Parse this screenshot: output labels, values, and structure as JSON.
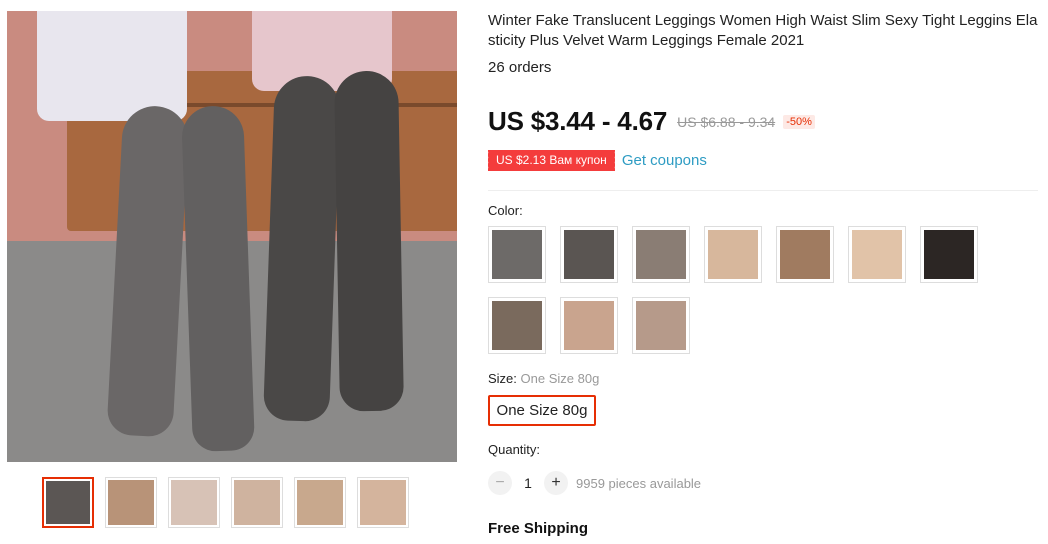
{
  "product": {
    "title": "Winter Fake Translucent Leggings Women High Waist Slim Sexy Tight Leggins Elasticity Plus Velvet Warm Leggings Female 2021",
    "orders": "26 orders",
    "price": "US $3.44 - 4.67",
    "original_price": "US $6.88 - 9.34",
    "discount": "-50%"
  },
  "coupon": {
    "label": "US $2.13 Вам купон",
    "link": "Get coupons"
  },
  "color": {
    "label": "Color:",
    "swatch_colors": [
      "#6d6a68",
      "#5a5552",
      "#8a7d74",
      "#d7b79c",
      "#a07b60",
      "#e1c3a8",
      "#2c2624",
      "#7a6a5d",
      "#c9a48e",
      "#b69a8a"
    ]
  },
  "size": {
    "label": "Size:",
    "selected_hint": "One Size 80g",
    "option": "One Size 80g"
  },
  "quantity": {
    "label": "Quantity:",
    "minus": "−",
    "value": "1",
    "plus": "+",
    "available": "9959 pieces available"
  },
  "shipping": {
    "label": "Free Shipping"
  },
  "gallery": {
    "thumb_colors": [
      "#5b5654",
      "#b89378",
      "#d7c2b6",
      "#cfb39f",
      "#c8a88d",
      "#d4b49d"
    ],
    "active_index": 0
  }
}
